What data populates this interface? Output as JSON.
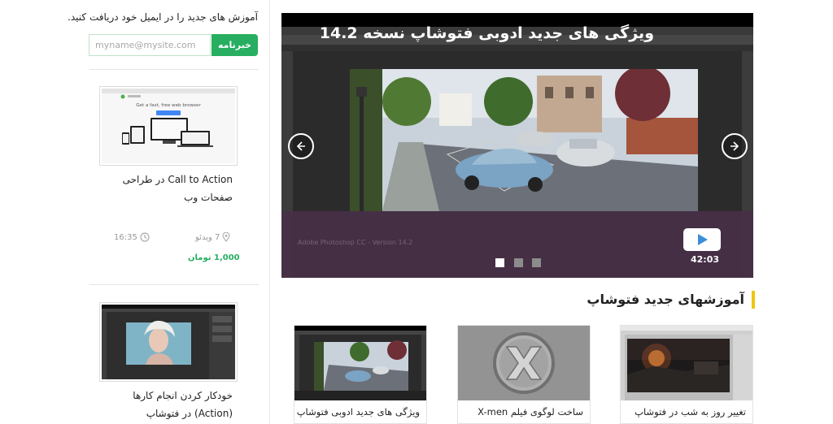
{
  "newsletter": {
    "text": "آموزش های جدید را در ایمیل خود دریافت کنید.",
    "placeholder": "myname@mysite.com",
    "button_label": "خبرنامه"
  },
  "sidebar_courses": [
    {
      "title_line1": "Call to Action در طراحی",
      "title_line2": "صفحات وب",
      "duration": "16:35",
      "videos": "7 ویدئو",
      "price": "1,000 تومان",
      "browser_headline": "Get a fast, free web browser"
    },
    {
      "title_line1": "خودکار کردن انجام کارها",
      "title_line2": "(Action) در فتوشاپ"
    }
  ],
  "slider": {
    "caption": "ویژگی های جدید ادوبی فتوشاپ نسخه 14.2",
    "duration": "42:03",
    "watermark": "Adobe Photoshop CC - Version 14.2",
    "active_slide": 0,
    "slides_count": 3
  },
  "section": {
    "title": "آموزشهای جدید فتوشاپ"
  },
  "cards": [
    {
      "title": "ویژگی های جدید ادوبی فتوشاپ"
    },
    {
      "title": "ساخت لوگوی فیلم X-men"
    },
    {
      "title": "تغییر روز به شب در فتوشاپ"
    }
  ],
  "icons": {
    "clock": "clock-icon",
    "location": "pin-icon",
    "play": "play-icon",
    "prev": "arrow-left-icon",
    "next": "arrow-right-icon"
  },
  "colors": {
    "accent_green": "#27ae60",
    "heading_bar": "#f1c40f",
    "caption_bg": "#483048"
  }
}
